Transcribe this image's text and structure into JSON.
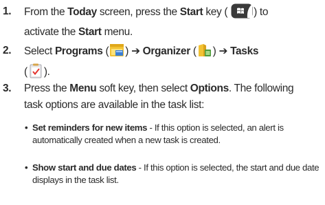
{
  "steps": [
    {
      "num": "1.",
      "p1": "From the ",
      "b1": "Today",
      "p2": " screen, press the ",
      "b2": "Start",
      "p3": " key (",
      "p4": ") to",
      "line2_p1": "activate the ",
      "line2_b1": "Start",
      "line2_p2": " menu."
    },
    {
      "num": "2.",
      "p1": "Select ",
      "b1": "Programs",
      "p2": " (",
      "p3": ") ",
      "arrow1": "➔",
      "b2": "Organizer",
      "p4": " (",
      "p5": ") ",
      "arrow2": "➔",
      "b3": "Tasks",
      "line2_p1": "(",
      "line2_p2": ")."
    },
    {
      "num": "3.",
      "p1": "Press the ",
      "b1": "Menu",
      "p2": " soft key, then select ",
      "b2": "Options",
      "p3": ". The following",
      "line2": "task options are available in the task list:"
    }
  ],
  "bullets": [
    {
      "mark": "•",
      "title": "Set reminders for new items",
      "text": " - If this option is selected, an alert is automatically created when a new task is created."
    },
    {
      "mark": "•",
      "title": "Show start and due dates",
      "text": " - If this option is selected, the start and due date displays in the task list."
    }
  ],
  "icons": {
    "start_key": "windows-start-key-icon",
    "programs": "programs-folder-icon",
    "organizer": "organizer-folder-icon",
    "tasks": "tasks-clipboard-icon"
  }
}
